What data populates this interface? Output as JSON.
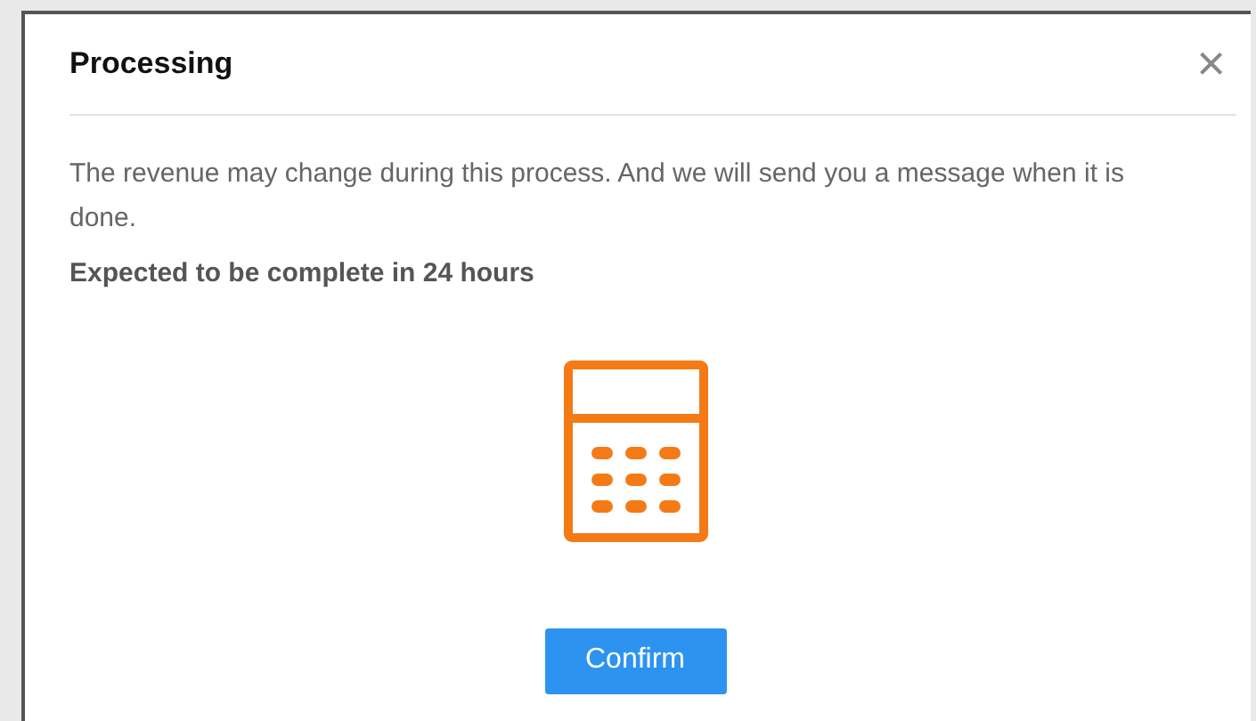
{
  "dialog": {
    "title": "Processing",
    "close_glyph": "×",
    "message": "The revenue may change during this process. And we will send you a message when it is done.",
    "note": "Expected to be complete in 24 hours",
    "confirm_button": "Confirm"
  }
}
